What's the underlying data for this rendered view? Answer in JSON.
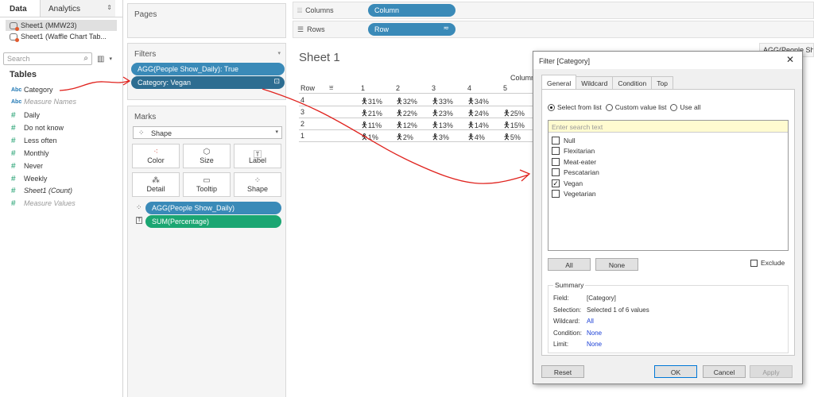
{
  "data_pane": {
    "tabs": [
      "Data",
      "Analytics"
    ],
    "sheets": [
      "Sheet1 (MMW23)",
      "Sheet1 (Waffle Chart Tab..."
    ],
    "search_placeholder": "Search",
    "tables_header": "Tables",
    "fields": [
      {
        "type": "Abc",
        "name": "Category"
      },
      {
        "type": "Abc",
        "name": "Measure Names"
      },
      {
        "type": "#",
        "name": "Daily"
      },
      {
        "type": "#",
        "name": "Do not know"
      },
      {
        "type": "#",
        "name": "Less often"
      },
      {
        "type": "#",
        "name": "Monthly"
      },
      {
        "type": "#",
        "name": "Never"
      },
      {
        "type": "#",
        "name": "Weekly"
      },
      {
        "type": "#",
        "name": "Sheet1 (Count)"
      },
      {
        "type": "#",
        "name": "Measure Values"
      }
    ]
  },
  "cards": {
    "pages": "Pages",
    "filters": "Filters",
    "filter_pills": [
      "AGG(People Show_Daily): True",
      "Category: Vegan"
    ],
    "marks": "Marks",
    "mark_type": "Shape",
    "mark_buttons": [
      {
        "label": "Color",
        "icon": "color-dots-icon"
      },
      {
        "label": "Size",
        "icon": "size-icon"
      },
      {
        "label": "Label",
        "icon": "label-icon"
      },
      {
        "label": "Detail",
        "icon": "detail-icon"
      },
      {
        "label": "Tooltip",
        "icon": "tooltip-icon"
      },
      {
        "label": "Shape",
        "icon": "shape-icon"
      }
    ],
    "mark_pills": [
      "AGG(People Show_Daily)",
      "SUM(Percentage)"
    ]
  },
  "shelves": {
    "columns_label": "Columns",
    "rows_label": "Rows",
    "columns_pill": "Column",
    "rows_pill": "Row",
    "right_pill": "AGG(People Sho..."
  },
  "sheet": {
    "title": "Sheet 1",
    "column_header": "Column",
    "row_header": "Row",
    "col_labels": [
      "1",
      "2",
      "3",
      "4",
      "5"
    ],
    "rows": [
      {
        "row": "4",
        "cells": [
          "31%",
          "32%",
          "33%",
          "34%",
          ""
        ]
      },
      {
        "row": "3",
        "cells": [
          "21%",
          "22%",
          "23%",
          "24%",
          "25%"
        ]
      },
      {
        "row": "2",
        "cells": [
          "11%",
          "12%",
          "13%",
          "14%",
          "15%"
        ]
      },
      {
        "row": "1",
        "cells": [
          "1%",
          "2%",
          "3%",
          "4%",
          "5%"
        ]
      }
    ]
  },
  "dialog": {
    "title": "Filter [Category]",
    "tabs": [
      "General",
      "Wildcard",
      "Condition",
      "Top"
    ],
    "radios": [
      "Select from list",
      "Custom value list",
      "Use all"
    ],
    "search_placeholder": "Enter search text",
    "items": [
      {
        "label": "Null",
        "checked": false
      },
      {
        "label": "Flexitarian",
        "checked": false
      },
      {
        "label": "Meat-eater",
        "checked": false
      },
      {
        "label": "Pescatarian",
        "checked": false
      },
      {
        "label": "Vegan",
        "checked": true
      },
      {
        "label": "Vegetarian",
        "checked": false
      }
    ],
    "all_label": "All",
    "none_label": "None",
    "exclude_label": "Exclude",
    "summary": {
      "title": "Summary",
      "field_k": "Field:",
      "field_v": "[Category]",
      "selection_k": "Selection:",
      "selection_v": "Selected 1 of 6 values",
      "wildcard_k": "Wildcard:",
      "wildcard_v": "All",
      "condition_k": "Condition:",
      "condition_v": "None",
      "limit_k": "Limit:",
      "limit_v": "None"
    },
    "reset": "Reset",
    "ok": "OK",
    "cancel": "Cancel",
    "apply": "Apply"
  },
  "colors": {
    "pill_blue": "#3a8ab8",
    "pill_green": "#1ba672",
    "annotation_red": "#e0231e",
    "dialog_bg": "#f0f0f0"
  }
}
